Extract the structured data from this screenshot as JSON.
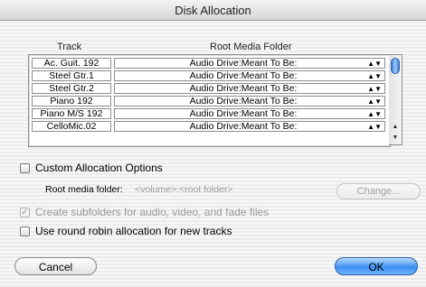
{
  "window": {
    "title": "Disk Allocation"
  },
  "table": {
    "headers": [
      "Track",
      "Root Media Folder"
    ],
    "rows": [
      {
        "track": "Ac. Guit. 192",
        "folder": "Audio Drive:Meant To Be:"
      },
      {
        "track": "Steel Gtr.1",
        "folder": "Audio Drive:Meant To Be:"
      },
      {
        "track": "Steel Gtr.2",
        "folder": "Audio Drive:Meant To Be:"
      },
      {
        "track": "Piano 192",
        "folder": "Audio Drive:Meant To Be:"
      },
      {
        "track": "Piano M/S 192",
        "folder": "Audio Drive:Meant To Be:"
      },
      {
        "track": "CelloMic.02",
        "folder": "Audio Drive:Meant To Be:"
      }
    ]
  },
  "options": {
    "custom_allocation": {
      "label": "Custom Allocation Options",
      "checked": false
    },
    "root_media_folder_label": "Root media folder:",
    "root_media_folder_value": "<volume>:<root folder>",
    "change_button": "Change...",
    "create_subfolders": {
      "label": "Create subfolders for audio, video, and fade files",
      "checked": true,
      "enabled": false
    },
    "round_robin": {
      "label": "Use round robin allocation for new tracks",
      "checked": false
    }
  },
  "buttons": {
    "cancel": "Cancel",
    "ok": "OK"
  },
  "colors": {
    "ok_accent": "#3d8ff0",
    "scroll_thumb": "#3b7fd6"
  }
}
